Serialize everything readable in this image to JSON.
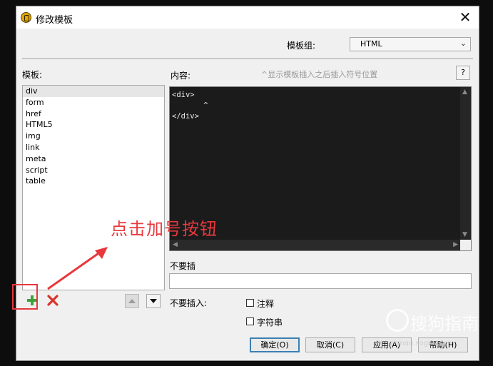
{
  "window": {
    "title": "修改模板"
  },
  "header": {
    "group_label": "模板组:",
    "group_value": "HTML"
  },
  "templates": {
    "label": "模板:",
    "items": [
      "div",
      "form",
      "href",
      "HTML5",
      "img",
      "link",
      "meta",
      "script",
      "table"
    ],
    "selected": "div"
  },
  "content": {
    "label": "内容:",
    "hint": "^显示模板插入之后插入符号位置",
    "help": "?",
    "code_lines": [
      "<div>",
      "       ^",
      "</div>"
    ]
  },
  "options": {
    "no_insert_label": "不要插",
    "no_insert_into_label": "不要插入:",
    "comment_label": "注释",
    "string_label": "字符串"
  },
  "buttons": {
    "ok": "确定(O)",
    "cancel": "取消(C)",
    "apply": "应用(A)",
    "help": "帮助(H)"
  },
  "annotation": {
    "text": "点击加号按钮",
    "color": "#e8383d"
  },
  "watermark": {
    "text": "搜狗指南",
    "sub": "zhinan.sogou.com"
  },
  "colors": {
    "add_icon": "#3aa33a",
    "delete_icon": "#d9342b",
    "editor_bg": "#1b1b1b"
  }
}
